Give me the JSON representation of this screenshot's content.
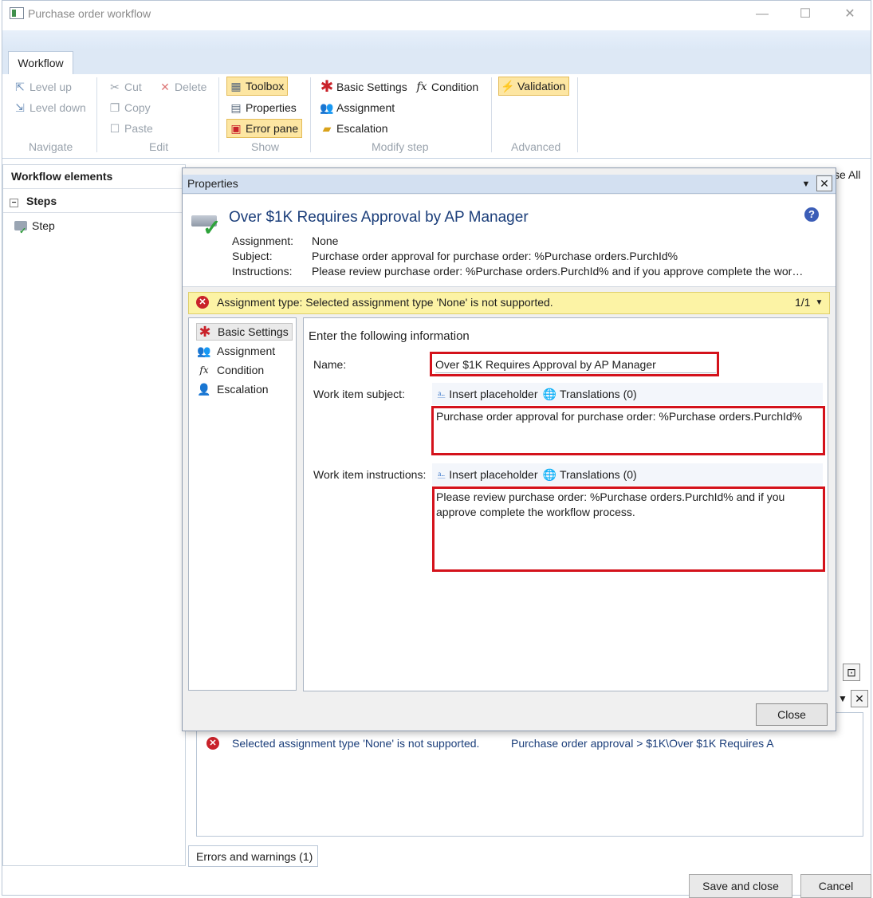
{
  "window": {
    "title": "Purchase order workflow",
    "minimize": "—",
    "maximize": "☐",
    "close": "✕"
  },
  "ribbon": {
    "tab": "Workflow",
    "navigate": {
      "label": "Navigate",
      "level_up": "Level up",
      "level_down": "Level down"
    },
    "edit": {
      "label": "Edit",
      "cut": "Cut",
      "delete": "Delete",
      "copy": "Copy",
      "paste": "Paste"
    },
    "show": {
      "label": "Show",
      "toolbox": "Toolbox",
      "properties": "Properties",
      "error_pane": "Error pane"
    },
    "modify_step": {
      "label": "Modify step",
      "basic_settings": "Basic Settings",
      "condition": "Condition",
      "assignment": "Assignment",
      "escalation": "Escalation"
    },
    "advanced": {
      "label": "Advanced",
      "validation": "Validation"
    }
  },
  "left_panel": {
    "header": "Workflow elements",
    "steps_label": "Steps",
    "step_item": "Step"
  },
  "canvas": {
    "collapse_all_fragment": "se All"
  },
  "dialog": {
    "title": "Properties",
    "heading": "Over $1K Requires Approval by AP Manager",
    "meta": {
      "assignment_label": "Assignment:",
      "assignment_value": "None",
      "subject_label": "Subject:",
      "subject_value": "Purchase order approval for purchase order: %Purchase orders.PurchId%",
      "instructions_label": "Instructions:",
      "instructions_value": "Please review purchase order: %Purchase orders.PurchId% and if you approve complete the wor…"
    },
    "warning": {
      "text": "Assignment type: Selected assignment type 'None' is not supported.",
      "counter": "1/1"
    },
    "nav": {
      "basic_settings": "Basic Settings",
      "assignment": "Assignment",
      "condition": "Condition",
      "escalation": "Escalation"
    },
    "form": {
      "intro": "Enter the following information",
      "name_label": "Name:",
      "name_value": "Over $1K Requires Approval by AP Manager",
      "subject_label": "Work item subject:",
      "subject_value": "Purchase order approval for purchase order: %Purchase orders.PurchId%",
      "instructions_label": "Work item instructions:",
      "instructions_value": "Please review purchase order: %Purchase orders.PurchId% and if you approve complete the workflow process.",
      "insert_placeholder": "Insert placeholder",
      "translations": "Translations (0)"
    },
    "close_button": "Close"
  },
  "error_pane": {
    "message": "Selected assignment type 'None' is not supported.",
    "path": "Purchase order approval > $1K\\Over $1K Requires A",
    "tab": "Errors and warnings (1)"
  },
  "footer": {
    "save_and_close": "Save and close",
    "cancel": "Cancel"
  }
}
